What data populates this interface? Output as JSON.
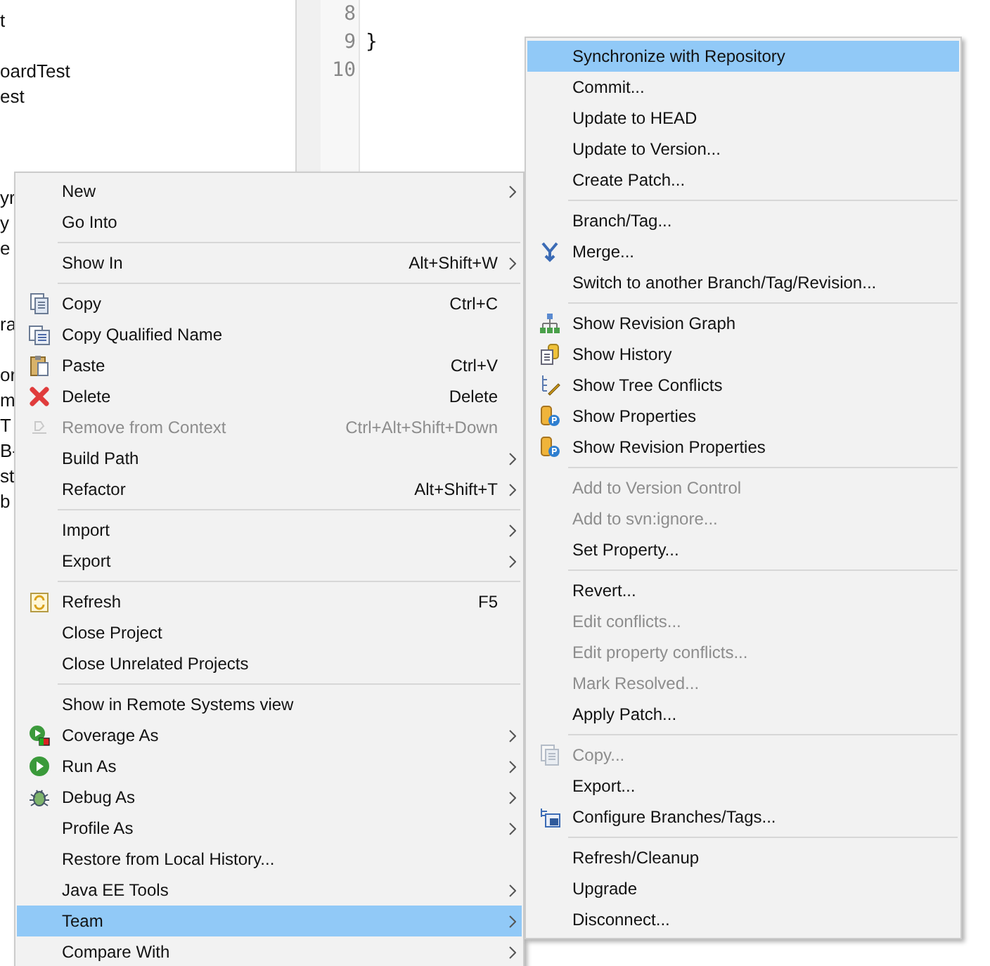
{
  "tree": {
    "rows": [
      {
        "text": "t"
      },
      {
        "text": "oardTest"
      },
      {
        "text": "est"
      },
      {
        "text": "yr"
      },
      {
        "text": "y"
      },
      {
        "text": "e"
      },
      {
        "text": "ra"
      },
      {
        "text": "or"
      },
      {
        "text": "m"
      },
      {
        "text": "T"
      },
      {
        "text": "B-"
      },
      {
        "text": "st"
      },
      {
        "text": "b"
      }
    ]
  },
  "editor": {
    "lines": [
      {
        "number": "8"
      },
      {
        "number": "9",
        "code": "}"
      },
      {
        "number": "10"
      }
    ]
  },
  "context_menu": {
    "items": [
      {
        "kind": "item",
        "label": "New",
        "submenu": true,
        "disabled": false,
        "selected": false
      },
      {
        "kind": "item",
        "label": "Go Into",
        "submenu": false,
        "disabled": false,
        "selected": false
      },
      {
        "kind": "separator"
      },
      {
        "kind": "item",
        "label": "Show In",
        "shortcut": "Alt+Shift+W",
        "submenu": true,
        "disabled": false,
        "selected": false
      },
      {
        "kind": "separator"
      },
      {
        "kind": "item",
        "label": "Copy",
        "shortcut": "Ctrl+C",
        "submenu": false,
        "disabled": false,
        "selected": false
      },
      {
        "kind": "item",
        "label": "Copy Qualified Name",
        "submenu": false,
        "disabled": false,
        "selected": false
      },
      {
        "kind": "item",
        "label": "Paste",
        "shortcut": "Ctrl+V",
        "submenu": false,
        "disabled": false,
        "selected": false
      },
      {
        "kind": "item",
        "label": "Delete",
        "shortcut": "Delete",
        "submenu": false,
        "disabled": false,
        "selected": false
      },
      {
        "kind": "item",
        "label": "Remove from Context",
        "shortcut": "Ctrl+Alt+Shift+Down",
        "submenu": false,
        "disabled": true,
        "selected": false
      },
      {
        "kind": "item",
        "label": "Build Path",
        "submenu": true,
        "disabled": false,
        "selected": false
      },
      {
        "kind": "item",
        "label": "Refactor",
        "shortcut": "Alt+Shift+T",
        "submenu": true,
        "disabled": false,
        "selected": false
      },
      {
        "kind": "separator"
      },
      {
        "kind": "item",
        "label": "Import",
        "submenu": true,
        "disabled": false,
        "selected": false
      },
      {
        "kind": "item",
        "label": "Export",
        "submenu": true,
        "disabled": false,
        "selected": false
      },
      {
        "kind": "separator"
      },
      {
        "kind": "item",
        "label": "Refresh",
        "shortcut": "F5",
        "submenu": false,
        "disabled": false,
        "selected": false
      },
      {
        "kind": "item",
        "label": "Close Project",
        "submenu": false,
        "disabled": false,
        "selected": false
      },
      {
        "kind": "item",
        "label": "Close Unrelated Projects",
        "submenu": false,
        "disabled": false,
        "selected": false
      },
      {
        "kind": "separator"
      },
      {
        "kind": "item",
        "label": "Show in Remote Systems view",
        "submenu": false,
        "disabled": false,
        "selected": false
      },
      {
        "kind": "item",
        "label": "Coverage As",
        "submenu": true,
        "disabled": false,
        "selected": false
      },
      {
        "kind": "item",
        "label": "Run As",
        "submenu": true,
        "disabled": false,
        "selected": false
      },
      {
        "kind": "item",
        "label": "Debug As",
        "submenu": true,
        "disabled": false,
        "selected": false
      },
      {
        "kind": "item",
        "label": "Profile As",
        "submenu": true,
        "disabled": false,
        "selected": false
      },
      {
        "kind": "item",
        "label": "Restore from Local History...",
        "submenu": false,
        "disabled": false,
        "selected": false
      },
      {
        "kind": "item",
        "label": "Java EE Tools",
        "submenu": true,
        "disabled": false,
        "selected": false
      },
      {
        "kind": "item",
        "label": "Team",
        "submenu": true,
        "disabled": false,
        "selected": true
      },
      {
        "kind": "item",
        "label": "Compare With",
        "submenu": true,
        "disabled": false,
        "selected": false
      }
    ]
  },
  "team_submenu": {
    "items": [
      {
        "kind": "item",
        "label": "Synchronize with Repository",
        "disabled": false,
        "selected": true
      },
      {
        "kind": "item",
        "label": "Commit...",
        "disabled": false,
        "selected": false
      },
      {
        "kind": "item",
        "label": "Update to HEAD",
        "disabled": false,
        "selected": false
      },
      {
        "kind": "item",
        "label": "Update to Version...",
        "disabled": false,
        "selected": false
      },
      {
        "kind": "item",
        "label": "Create Patch...",
        "disabled": false,
        "selected": false
      },
      {
        "kind": "separator"
      },
      {
        "kind": "item",
        "label": "Branch/Tag...",
        "disabled": false,
        "selected": false
      },
      {
        "kind": "item",
        "label": "Merge...",
        "disabled": false,
        "selected": false
      },
      {
        "kind": "item",
        "label": "Switch to another Branch/Tag/Revision...",
        "disabled": false,
        "selected": false
      },
      {
        "kind": "separator"
      },
      {
        "kind": "item",
        "label": "Show Revision Graph",
        "disabled": false,
        "selected": false
      },
      {
        "kind": "item",
        "label": "Show History",
        "disabled": false,
        "selected": false
      },
      {
        "kind": "item",
        "label": "Show Tree Conflicts",
        "disabled": false,
        "selected": false
      },
      {
        "kind": "item",
        "label": "Show Properties",
        "disabled": false,
        "selected": false
      },
      {
        "kind": "item",
        "label": "Show Revision Properties",
        "disabled": false,
        "selected": false
      },
      {
        "kind": "separator"
      },
      {
        "kind": "item",
        "label": "Add to Version Control",
        "disabled": true,
        "selected": false
      },
      {
        "kind": "item",
        "label": "Add to svn:ignore...",
        "disabled": true,
        "selected": false
      },
      {
        "kind": "item",
        "label": "Set Property...",
        "disabled": false,
        "selected": false
      },
      {
        "kind": "separator"
      },
      {
        "kind": "item",
        "label": "Revert...",
        "disabled": false,
        "selected": false
      },
      {
        "kind": "item",
        "label": "Edit conflicts...",
        "disabled": true,
        "selected": false
      },
      {
        "kind": "item",
        "label": "Edit property conflicts...",
        "disabled": true,
        "selected": false
      },
      {
        "kind": "item",
        "label": "Mark Resolved...",
        "disabled": true,
        "selected": false
      },
      {
        "kind": "item",
        "label": "Apply Patch...",
        "disabled": false,
        "selected": false
      },
      {
        "kind": "separator"
      },
      {
        "kind": "item",
        "label": "Copy...",
        "disabled": true,
        "selected": false
      },
      {
        "kind": "item",
        "label": "Export...",
        "disabled": false,
        "selected": false
      },
      {
        "kind": "item",
        "label": "Configure Branches/Tags...",
        "disabled": false,
        "selected": false
      },
      {
        "kind": "separator"
      },
      {
        "kind": "item",
        "label": "Refresh/Cleanup",
        "disabled": false,
        "selected": false
      },
      {
        "kind": "item",
        "label": "Upgrade",
        "disabled": false,
        "selected": false
      },
      {
        "kind": "item",
        "label": "Disconnect...",
        "disabled": false,
        "selected": false
      }
    ]
  }
}
